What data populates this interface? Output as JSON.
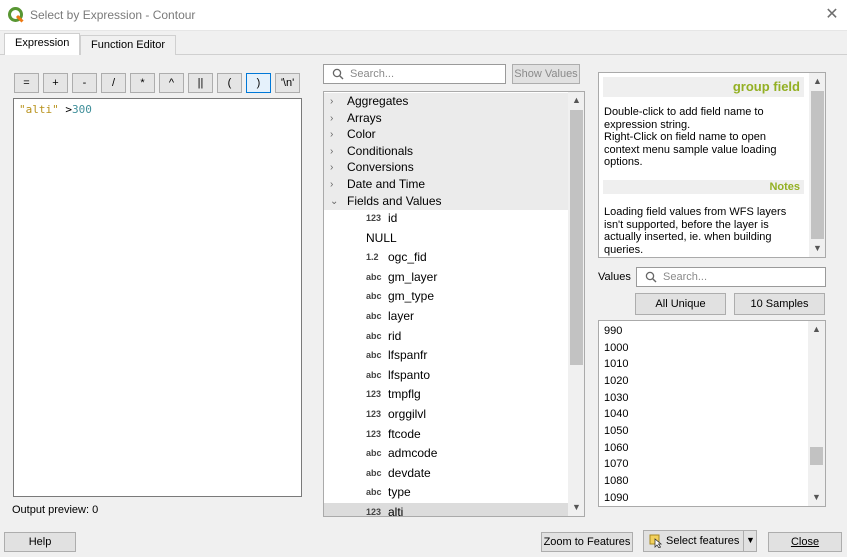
{
  "window": {
    "title": "Select by Expression - Contour"
  },
  "tabs": [
    {
      "label": "Expression"
    },
    {
      "label": "Function Editor"
    }
  ],
  "operators": [
    "=",
    "+",
    "-",
    "/",
    "*",
    "^",
    "||",
    "(",
    ")",
    "'\\n'"
  ],
  "expression": {
    "field": "\"alti\"",
    "operator": " >",
    "value": "300"
  },
  "output_preview": "Output preview:  0",
  "function_search": {
    "placeholder": "Search...",
    "show_values_label": "Show Values"
  },
  "tree": {
    "groups": [
      "Aggregates",
      "Arrays",
      "Color",
      "Conditionals",
      "Conversions",
      "Date and Time",
      "Fields and Values"
    ],
    "fields": [
      {
        "type": "123",
        "name": "id"
      },
      {
        "type": "",
        "name": "NULL"
      },
      {
        "type": "1.2",
        "name": "ogc_fid"
      },
      {
        "type": "abc",
        "name": "gm_layer"
      },
      {
        "type": "abc",
        "name": "gm_type"
      },
      {
        "type": "abc",
        "name": "layer"
      },
      {
        "type": "abc",
        "name": "rid"
      },
      {
        "type": "abc",
        "name": "lfspanfr"
      },
      {
        "type": "abc",
        "name": "lfspanto"
      },
      {
        "type": "123",
        "name": "tmpflg"
      },
      {
        "type": "123",
        "name": "orggilvl"
      },
      {
        "type": "123",
        "name": "ftcode"
      },
      {
        "type": "abc",
        "name": "admcode"
      },
      {
        "type": "abc",
        "name": "devdate"
      },
      {
        "type": "abc",
        "name": "type"
      },
      {
        "type": "123",
        "name": "alti"
      }
    ]
  },
  "help": {
    "heading": "group field",
    "text1": "Double-click to add field name to expression string.",
    "text2": "Right-Click on field name to open context menu sample value loading options.",
    "notes_heading": "Notes",
    "notes_text": "Loading field values from WFS layers isn't supported, before the layer is actually inserted, ie. when building queries."
  },
  "values_panel": {
    "label": "Values",
    "search_placeholder": "Search...",
    "all_unique_label": "All Unique",
    "samples_label": "10 Samples",
    "items": [
      "990",
      "1000",
      "1010",
      "1020",
      "1030",
      "1040",
      "1050",
      "1060",
      "1070",
      "1080",
      "1090"
    ]
  },
  "footer": {
    "help_label": "Help",
    "zoom_label": "Zoom to Features",
    "select_label": "Select features",
    "close_label": "Close"
  },
  "colors": {
    "accent": "#0078d7",
    "help_heading": "#93b023",
    "field_text": "#b8921c",
    "number_text": "#3f8f9a"
  }
}
